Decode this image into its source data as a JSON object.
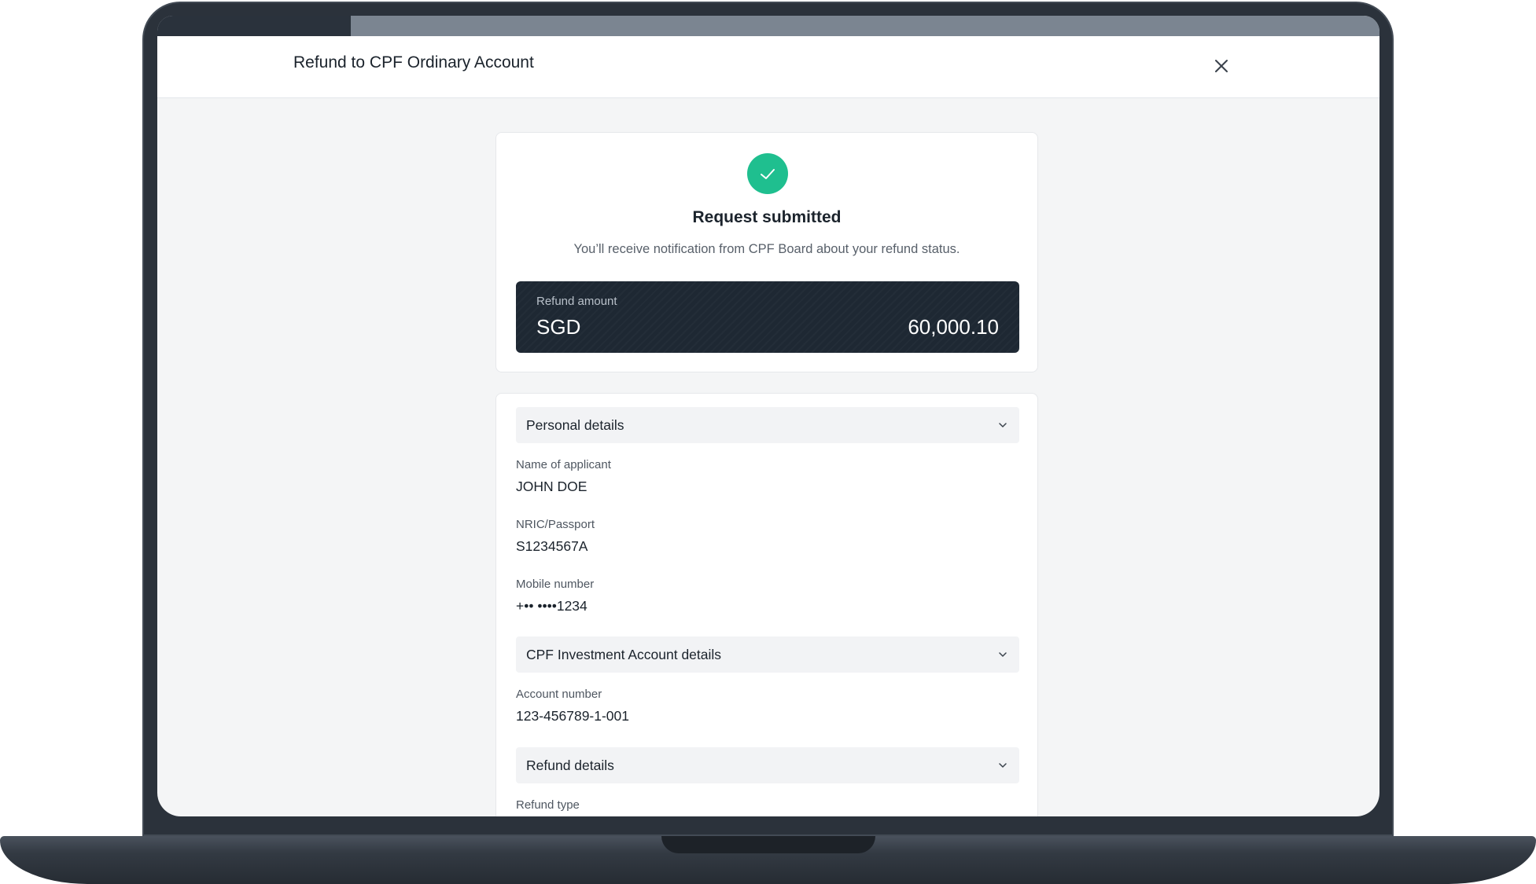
{
  "header": {
    "title": "Refund to CPF Ordinary Account",
    "close_icon": "close-icon"
  },
  "success": {
    "icon": "check-icon",
    "title": "Request submitted",
    "message": "You’ll receive notification from CPF Board about your refund status.",
    "accent_color": "#1fbf8f"
  },
  "refund_amount": {
    "label": "Refund amount",
    "currency": "SGD",
    "value": "60,000.10"
  },
  "sections": {
    "personal": {
      "title": "Personal details",
      "fields": [
        {
          "label": "Name of applicant",
          "value": "JOHN DOE"
        },
        {
          "label": "NRIC/Passport",
          "value": "S1234567A"
        },
        {
          "label": "Mobile number",
          "value": "+•• ••••1234"
        }
      ]
    },
    "investment": {
      "title": "CPF Investment Account details",
      "fields": [
        {
          "label": "Account number",
          "value": "123-456789-1-001"
        }
      ]
    },
    "refund": {
      "title": "Refund details",
      "fields": [
        {
          "label": "Refund type",
          "value": ""
        }
      ]
    }
  }
}
